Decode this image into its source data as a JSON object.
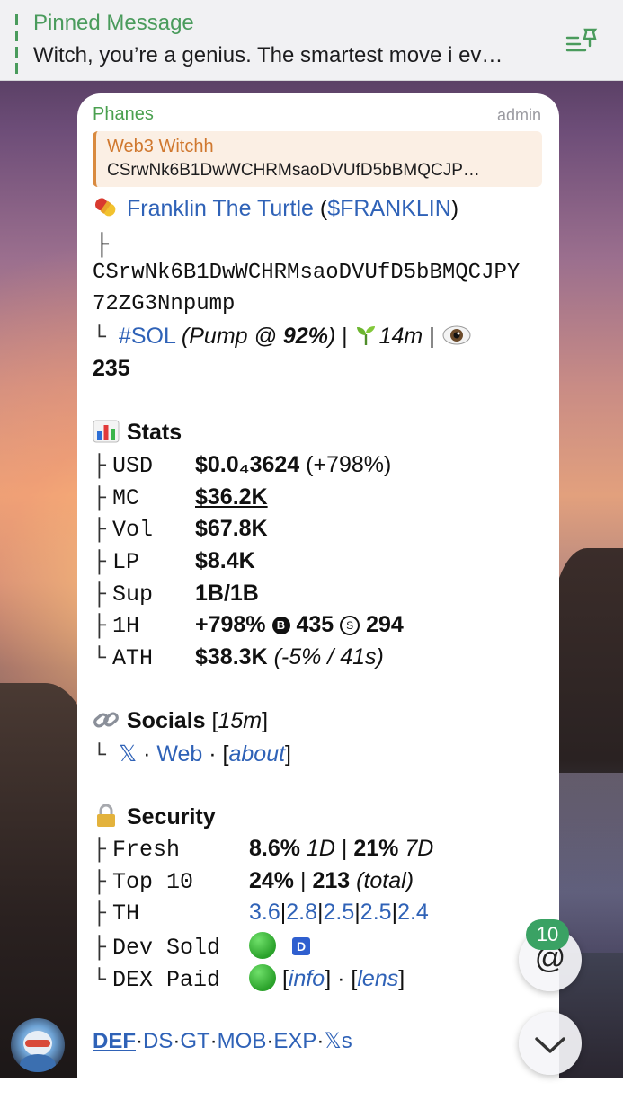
{
  "pinned": {
    "title": "Pinned Message",
    "text": "Witch, you’re a genius. The smartest move i ev…"
  },
  "message": {
    "sender": "Phanes",
    "role": "admin",
    "reply": {
      "name": "Web3 Witchh",
      "text": "CSrwNk6B1DwWCHRMsaoDVUfD5bBMQCJP…"
    },
    "token_name": "Franklin The Turtle",
    "token_ticker": "$FRANKLIN",
    "tree_top": "├",
    "address_line1": "CSrwNk6B1DwWCHRMsaoDVUfD5bBMQCJPY",
    "address_line2": "72ZG3Nnpump",
    "chain_tag": "#SOL",
    "chain_info_prefix": "(Pump @ ",
    "chain_pct": "92%",
    "chain_info_suffix": ")",
    "age": "14m",
    "views": "235",
    "stats_heading": "Stats",
    "stats": {
      "usd_label": "USD",
      "usd_value": "$0.0₄3624",
      "usd_change": "(+798%)",
      "mc_label": "MC",
      "mc_value": "$36.2K",
      "vol_label": "Vol",
      "vol_value": "$67.8K",
      "lp_label": "LP",
      "lp_value": "$8.4K",
      "sup_label": "Sup",
      "sup_value": "1B/1B",
      "h1_label": "1H",
      "h1_change": "+798%",
      "h1_buys": "435",
      "h1_sells": "294",
      "ath_label": "ATH",
      "ath_value": "$38.3K",
      "ath_note": "(-5% / 41s)"
    },
    "socials_heading": "Socials",
    "socials_age": "15m",
    "socials": {
      "x": "𝕏",
      "web": "Web",
      "about": "about"
    },
    "security_heading": "Security",
    "security": {
      "fresh_label": "Fresh",
      "fresh_1d": "8.6%",
      "fresh_1d_unit": "1D",
      "fresh_7d": "21%",
      "fresh_7d_unit": "7D",
      "top10_label": "Top 10",
      "top10_pct": "24%",
      "top10_total": "213",
      "top10_total_unit": "(total)",
      "th_label": "TH",
      "th_values": [
        "3.6",
        "2.8",
        "2.5",
        "2.5",
        "2.4"
      ],
      "dev_label": "Dev Sold",
      "dev_badge": "D",
      "dex_label": "DEX Paid",
      "dex_info": "info",
      "dex_lens": "lens"
    },
    "footer_links": [
      "DEF",
      "DS",
      "GT",
      "MOB",
      "EXP",
      "𝕏s"
    ]
  },
  "mention_count": "10",
  "mention_symbol": "@",
  "colors": {
    "accent_green": "#4aa04f",
    "link_blue": "#2f62b7",
    "reply_orange": "#d0782f",
    "badge_green": "#3aa264"
  }
}
